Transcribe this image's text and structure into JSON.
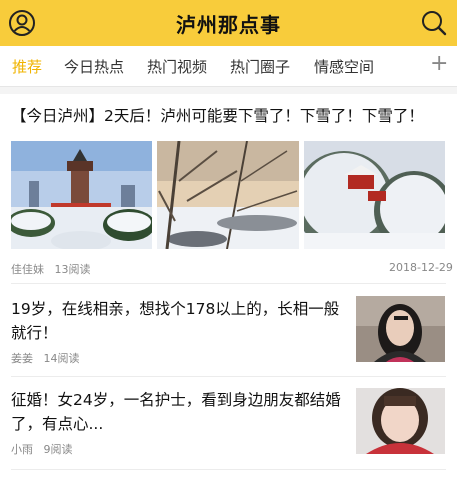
{
  "header": {
    "title": "泸州那点事",
    "user_icon": "user-icon",
    "search_icon": "search-icon",
    "accent_color": "#f8cc3b"
  },
  "tabs": [
    {
      "label": "推荐",
      "active": true
    },
    {
      "label": "今日热点",
      "active": false
    },
    {
      "label": "热门视频",
      "active": false
    },
    {
      "label": "热门圈子",
      "active": false
    },
    {
      "label": "情感空间",
      "active": false
    }
  ],
  "add_tab_label": "+",
  "feed": [
    {
      "title": "【今日泸州】2天后！泸州可能要下雪了！下雪了！下雪了！",
      "author": "佳佳妹",
      "reads": "13阅读",
      "date": "2018-12-29"
    },
    {
      "title": "19岁，在线相亲，想找个178以上的，长相一般就行！",
      "author": "姜姜",
      "reads": "14阅读"
    },
    {
      "title": "征婚！女24岁，一名护士，看到身边朋友都结婚了，有点心...",
      "author": "小雨",
      "reads": "9阅读"
    }
  ]
}
